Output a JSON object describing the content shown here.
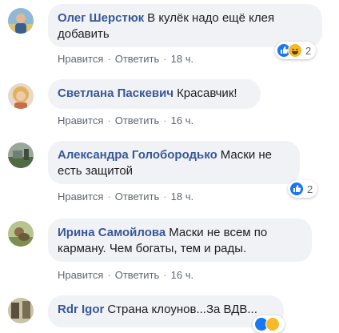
{
  "comments": [
    {
      "author": "Олег Шерстюк",
      "text_line1": "В кулёк надо ещё клея",
      "text_line2": "добавить",
      "like": "Нравится",
      "reply": "Ответить",
      "time": "18 ч.",
      "reactions": {
        "icons": [
          "like-icon",
          "haha-icon"
        ],
        "count": "2"
      }
    },
    {
      "author": "Светлана Паскевич",
      "text_line1": "Красавчик!",
      "like": "Нравится",
      "reply": "Ответить",
      "time": "16 ч."
    },
    {
      "author": "Александра Голобородько",
      "text_line1": "Маски не",
      "text_line2": "есть защитой",
      "like": "Нравится",
      "reply": "Ответить",
      "time": "18 ч.",
      "reactions": {
        "icons": [
          "like-icon"
        ],
        "count": "2"
      }
    },
    {
      "author": "Ирина Самойлова",
      "text_line1": "Маски не всем по",
      "text_line2": "карману. Чем богаты, тем и рады.",
      "like": "Нравится",
      "reply": "Ответить",
      "time": "16 ч."
    },
    {
      "author": "Rdr Igor",
      "text_line1": "Страна клоунов...За ВДВ..."
    }
  ],
  "colors": {
    "author": "#385898",
    "bubble": "#f0f2f5",
    "meta": "#616770",
    "like": "#1877f2",
    "haha": "#f7b928"
  },
  "separator": "·"
}
